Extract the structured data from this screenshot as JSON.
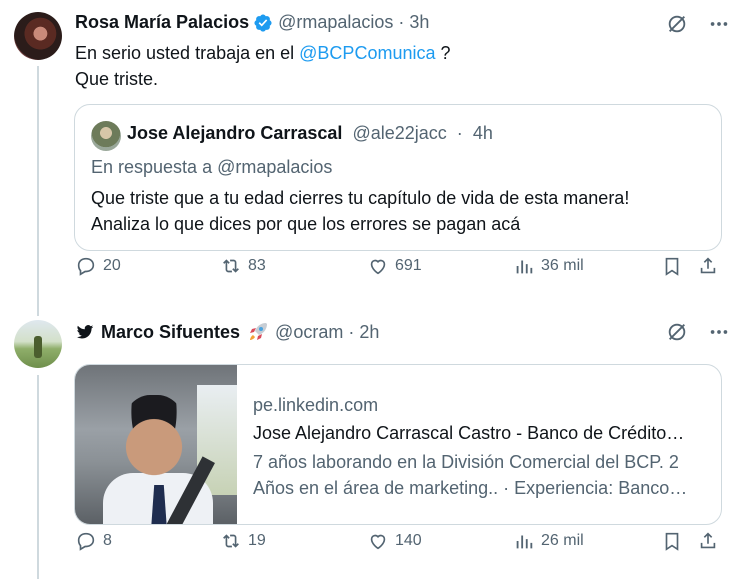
{
  "post1": {
    "author_name": "Rosa María Palacios",
    "handle": "@rmapalacios",
    "separator": "·",
    "time": "3h",
    "text_before": "En serio usted trabaja en el",
    "mention": "@BCPComunica",
    "text_after": "?",
    "text_line2": "Que triste.",
    "quote": {
      "author_name": "Jose Alejandro Carrascal",
      "handle": "@ale22jacc",
      "separator": "·",
      "time": "4h",
      "reply_prefix": "En respuesta a",
      "reply_to": "@rmapalacios",
      "text_line1": "Que triste que a tu edad cierres tu capítulo de vida de esta manera!",
      "text_line2": "Analiza lo que dices por que los errores se pagan acá"
    },
    "actions": {
      "replies": "20",
      "reposts": "83",
      "likes": "691",
      "views": "36 mil"
    }
  },
  "post2": {
    "author_name": "Marco Sifuentes",
    "handle": "@ocram",
    "separator": "·",
    "time": "2h",
    "card": {
      "domain": "pe.linkedin.com",
      "title": "Jose Alejandro Carrascal Castro - Banco de Crédito…",
      "desc_line1": "7 años laborando en la División Comercial del BCP. 2",
      "desc_line2": "Años en el área de marketing.. · Experiencia: Banco…"
    },
    "actions": {
      "replies": "8",
      "reposts": "19",
      "likes": "140",
      "views": "26 mil"
    }
  },
  "colors": {
    "accent": "#1d9bf0",
    "muted": "#536471",
    "text": "#0f1419",
    "border": "#cfd9de"
  }
}
